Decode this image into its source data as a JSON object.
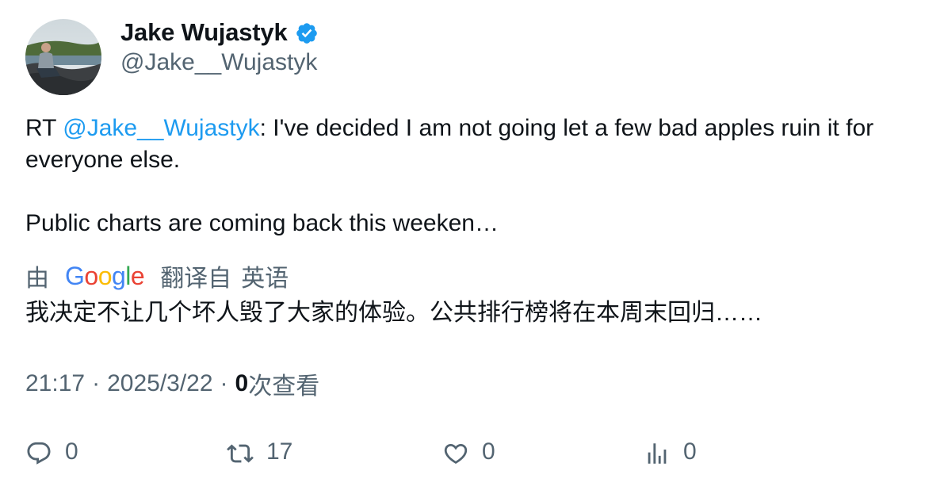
{
  "author": {
    "display_name": "Jake Wujastyk",
    "handle": "@Jake__Wujastyk",
    "verified": true
  },
  "tweet": {
    "prefix": "RT ",
    "mention": "@Jake__Wujastyk",
    "line1_rest": ": I've decided I am not going let a few bad apples ruin it for everyone else.",
    "line2": "Public charts are coming back this weeken…"
  },
  "translation": {
    "by_label": "由",
    "provider": "Google",
    "translated_from": "翻译自",
    "language": "英语",
    "text": "我决定不让几个坏人毁了大家的体验。公共排行榜将在本周末回归……"
  },
  "meta": {
    "time": "21:17",
    "date": "2025/3/22",
    "views_count": "0",
    "views_label": "次查看"
  },
  "actions": {
    "reply_count": "0",
    "retweet_count": "17",
    "like_count": "0",
    "views_count": "0"
  },
  "colors": {
    "link": "#1d9bf0",
    "muted": "#536471",
    "text": "#0f1419",
    "verified": "#1d9bf0"
  }
}
